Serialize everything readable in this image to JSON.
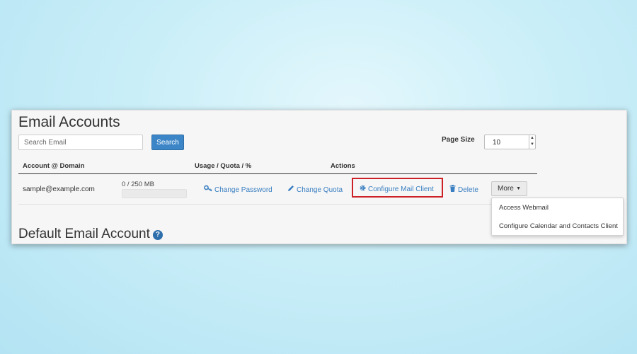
{
  "page": {
    "title": "Email Accounts",
    "subtitle": "Default Email Account"
  },
  "search": {
    "placeholder": "Search Email",
    "button_label": "Search"
  },
  "page_size": {
    "label": "Page Size",
    "value": "10"
  },
  "table": {
    "headers": {
      "account": "Account @ Domain",
      "usage": "Usage / Quota / %",
      "actions": "Actions"
    },
    "rows": [
      {
        "email": "sample@example.com",
        "quota": "0 / 250 MB",
        "usage_fraction": 0,
        "actions": {
          "change_password": "Change Password",
          "change_quota": "Change Quota",
          "configure_mail_client": "Configure Mail Client",
          "delete": "Delete",
          "more": "More"
        }
      }
    ]
  },
  "more_menu": {
    "items": [
      "Access Webmail",
      "Configure Calendar and Contacts Client"
    ]
  },
  "icons": {
    "change_password": "key-icon",
    "change_quota": "pencil-icon",
    "configure_mail_client": "gear-icon",
    "delete": "trash-icon",
    "help": "question-circle-icon"
  },
  "colors": {
    "link": "#3a7fc1",
    "primary_button": "#3c86c8",
    "highlight_border": "#cc2127",
    "help_icon": "#2d6eab"
  }
}
